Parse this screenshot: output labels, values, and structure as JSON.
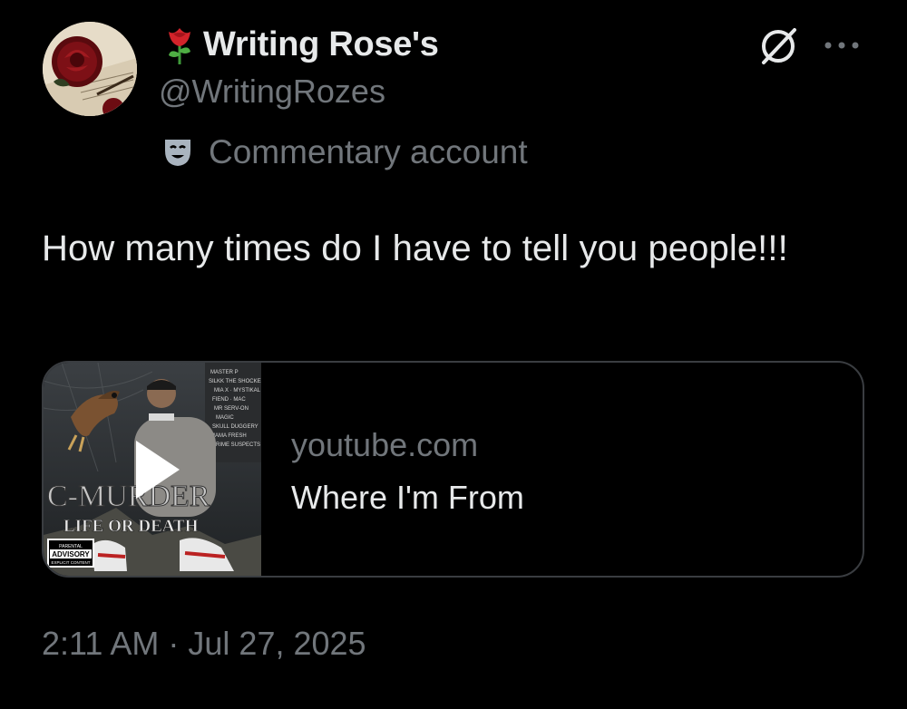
{
  "tweet": {
    "author": {
      "display_name": "Writing Rose's",
      "name_emoji": "rose-emoji",
      "handle": "@WritingRozes",
      "account_label": "Commentary account",
      "account_label_icon": "theater-mask-icon"
    },
    "header_actions": {
      "grok_icon": "grok-icon",
      "more_icon": "more-horizontal-icon"
    },
    "text": "How many times do I have to tell you people!!!",
    "link_card": {
      "domain": "youtube.com",
      "title": "Where I'm From",
      "thumbnail": {
        "play_icon": "play-icon",
        "album_artist_text": "C-MURDER",
        "album_title_text": "LIFE OR DEATH",
        "advisory_text": "PARENTAL ADVISORY EXPLICIT CONTENT"
      }
    },
    "timestamp": "2:11 AM · Jul 27, 2025"
  },
  "colors": {
    "background": "#000000",
    "primary_text": "#e7e9ea",
    "secondary_text": "#71767b",
    "card_border": "#3a3d41"
  }
}
